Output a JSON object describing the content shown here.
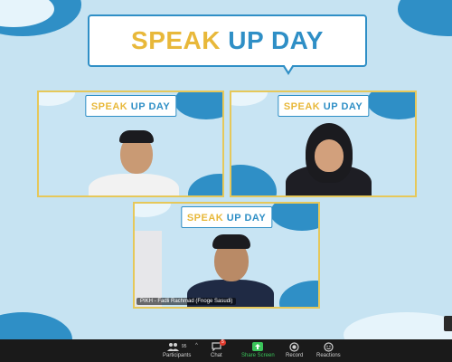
{
  "event": {
    "title_parts": [
      "SPEAK",
      "UP",
      "DAY"
    ]
  },
  "tiles": [
    {
      "name": ""
    },
    {
      "name": ""
    },
    {
      "name": "PIKH - Fadli Rachmad (Fnoge Sasudi)"
    }
  ],
  "toolbar": {
    "participants_label": "Participants",
    "participants_count": "95",
    "chat_label": "Chat",
    "chat_badge": "5",
    "share_label": "Share Screen",
    "record_label": "Record",
    "reactions_label": "Reactions"
  },
  "colors": {
    "accent_blue": "#2f8fc6",
    "accent_gold": "#e8b83a",
    "share_green": "#3ac45a",
    "toolbar_bg": "#1a1a1a"
  }
}
